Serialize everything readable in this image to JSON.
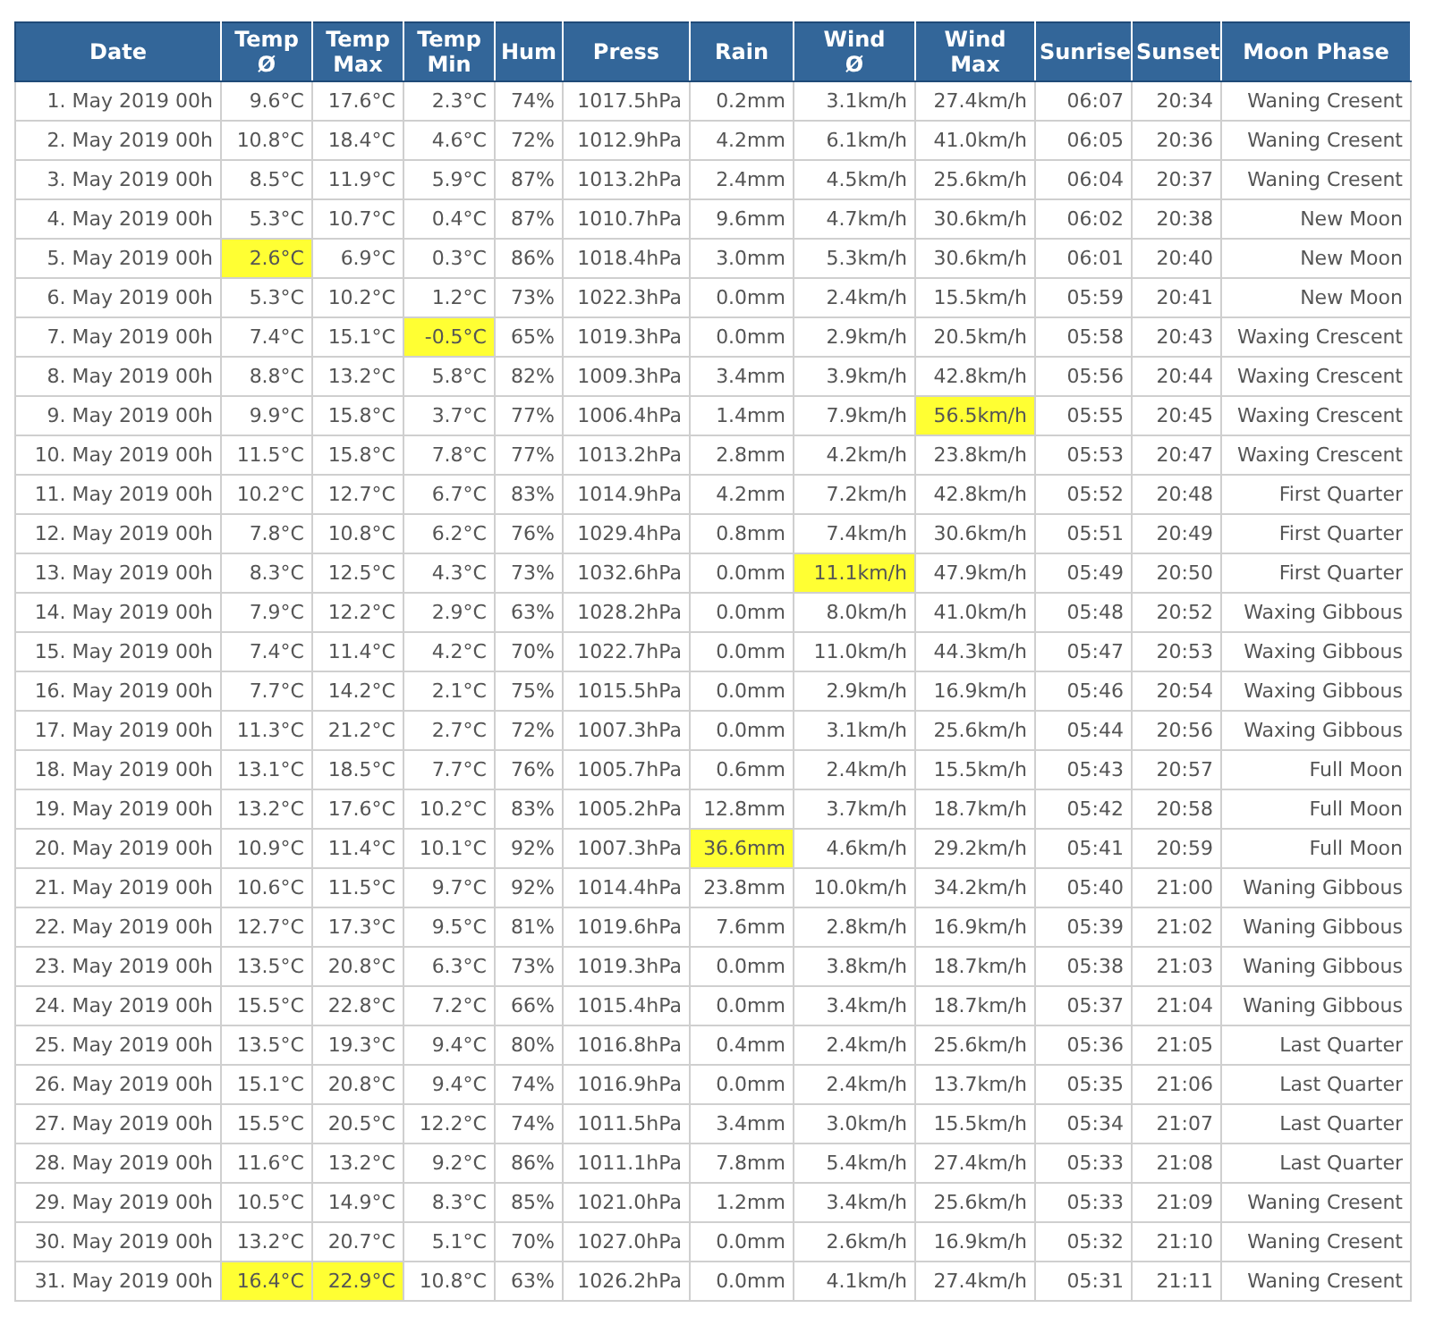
{
  "table": {
    "columns": [
      "Date",
      "Temp\nØ",
      "Temp\nMax",
      "Temp\nMin",
      "Hum",
      "Press",
      "Rain",
      "Wind\nØ",
      "Wind\nMax",
      "Sunrise",
      "Sunset",
      "Moon Phase"
    ],
    "rows": [
      {
        "cells": [
          "1. May 2019 00h",
          "9.6°C",
          "17.6°C",
          "2.3°C",
          "74%",
          "1017.5hPa",
          "0.2mm",
          "3.1km/h",
          "27.4km/h",
          "06:07",
          "20:34",
          "Waning Cresent"
        ],
        "highlighted": [
          false,
          false,
          false,
          false,
          false,
          false,
          false,
          false,
          false,
          false,
          false,
          false
        ]
      },
      {
        "cells": [
          "2. May 2019 00h",
          "10.8°C",
          "18.4°C",
          "4.6°C",
          "72%",
          "1012.9hPa",
          "4.2mm",
          "6.1km/h",
          "41.0km/h",
          "06:05",
          "20:36",
          "Waning Cresent"
        ],
        "highlighted": [
          false,
          false,
          false,
          false,
          false,
          false,
          false,
          false,
          false,
          false,
          false,
          false
        ]
      },
      {
        "cells": [
          "3. May 2019 00h",
          "8.5°C",
          "11.9°C",
          "5.9°C",
          "87%",
          "1013.2hPa",
          "2.4mm",
          "4.5km/h",
          "25.6km/h",
          "06:04",
          "20:37",
          "Waning Cresent"
        ],
        "highlighted": [
          false,
          false,
          false,
          false,
          false,
          false,
          false,
          false,
          false,
          false,
          false,
          false
        ]
      },
      {
        "cells": [
          "4. May 2019 00h",
          "5.3°C",
          "10.7°C",
          "0.4°C",
          "87%",
          "1010.7hPa",
          "9.6mm",
          "4.7km/h",
          "30.6km/h",
          "06:02",
          "20:38",
          "New Moon"
        ],
        "highlighted": [
          false,
          false,
          false,
          false,
          false,
          false,
          false,
          false,
          false,
          false,
          false,
          false
        ]
      },
      {
        "cells": [
          "5. May 2019 00h",
          "2.6°C",
          "6.9°C",
          "0.3°C",
          "86%",
          "1018.4hPa",
          "3.0mm",
          "5.3km/h",
          "30.6km/h",
          "06:01",
          "20:40",
          "New Moon"
        ],
        "highlighted": [
          false,
          true,
          false,
          false,
          false,
          false,
          false,
          false,
          false,
          false,
          false,
          false
        ]
      },
      {
        "cells": [
          "6. May 2019 00h",
          "5.3°C",
          "10.2°C",
          "1.2°C",
          "73%",
          "1022.3hPa",
          "0.0mm",
          "2.4km/h",
          "15.5km/h",
          "05:59",
          "20:41",
          "New Moon"
        ],
        "highlighted": [
          false,
          false,
          false,
          false,
          false,
          false,
          false,
          false,
          false,
          false,
          false,
          false
        ]
      },
      {
        "cells": [
          "7. May 2019 00h",
          "7.4°C",
          "15.1°C",
          "-0.5°C",
          "65%",
          "1019.3hPa",
          "0.0mm",
          "2.9km/h",
          "20.5km/h",
          "05:58",
          "20:43",
          "Waxing Crescent"
        ],
        "highlighted": [
          false,
          false,
          false,
          true,
          false,
          false,
          false,
          false,
          false,
          false,
          false,
          false
        ]
      },
      {
        "cells": [
          "8. May 2019 00h",
          "8.8°C",
          "13.2°C",
          "5.8°C",
          "82%",
          "1009.3hPa",
          "3.4mm",
          "3.9km/h",
          "42.8km/h",
          "05:56",
          "20:44",
          "Waxing Crescent"
        ],
        "highlighted": [
          false,
          false,
          false,
          false,
          false,
          false,
          false,
          false,
          false,
          false,
          false,
          false
        ]
      },
      {
        "cells": [
          "9. May 2019 00h",
          "9.9°C",
          "15.8°C",
          "3.7°C",
          "77%",
          "1006.4hPa",
          "1.4mm",
          "7.9km/h",
          "56.5km/h",
          "05:55",
          "20:45",
          "Waxing Crescent"
        ],
        "highlighted": [
          false,
          false,
          false,
          false,
          false,
          false,
          false,
          false,
          true,
          false,
          false,
          false
        ]
      },
      {
        "cells": [
          "10. May 2019 00h",
          "11.5°C",
          "15.8°C",
          "7.8°C",
          "77%",
          "1013.2hPa",
          "2.8mm",
          "4.2km/h",
          "23.8km/h",
          "05:53",
          "20:47",
          "Waxing Crescent"
        ],
        "highlighted": [
          false,
          false,
          false,
          false,
          false,
          false,
          false,
          false,
          false,
          false,
          false,
          false
        ]
      },
      {
        "cells": [
          "11. May 2019 00h",
          "10.2°C",
          "12.7°C",
          "6.7°C",
          "83%",
          "1014.9hPa",
          "4.2mm",
          "7.2km/h",
          "42.8km/h",
          "05:52",
          "20:48",
          "First Quarter"
        ],
        "highlighted": [
          false,
          false,
          false,
          false,
          false,
          false,
          false,
          false,
          false,
          false,
          false,
          false
        ]
      },
      {
        "cells": [
          "12. May 2019 00h",
          "7.8°C",
          "10.8°C",
          "6.2°C",
          "76%",
          "1029.4hPa",
          "0.8mm",
          "7.4km/h",
          "30.6km/h",
          "05:51",
          "20:49",
          "First Quarter"
        ],
        "highlighted": [
          false,
          false,
          false,
          false,
          false,
          false,
          false,
          false,
          false,
          false,
          false,
          false
        ]
      },
      {
        "cells": [
          "13. May 2019 00h",
          "8.3°C",
          "12.5°C",
          "4.3°C",
          "73%",
          "1032.6hPa",
          "0.0mm",
          "11.1km/h",
          "47.9km/h",
          "05:49",
          "20:50",
          "First Quarter"
        ],
        "highlighted": [
          false,
          false,
          false,
          false,
          false,
          false,
          false,
          true,
          false,
          false,
          false,
          false
        ]
      },
      {
        "cells": [
          "14. May 2019 00h",
          "7.9°C",
          "12.2°C",
          "2.9°C",
          "63%",
          "1028.2hPa",
          "0.0mm",
          "8.0km/h",
          "41.0km/h",
          "05:48",
          "20:52",
          "Waxing Gibbous"
        ],
        "highlighted": [
          false,
          false,
          false,
          false,
          false,
          false,
          false,
          false,
          false,
          false,
          false,
          false
        ]
      },
      {
        "cells": [
          "15. May 2019 00h",
          "7.4°C",
          "11.4°C",
          "4.2°C",
          "70%",
          "1022.7hPa",
          "0.0mm",
          "11.0km/h",
          "44.3km/h",
          "05:47",
          "20:53",
          "Waxing Gibbous"
        ],
        "highlighted": [
          false,
          false,
          false,
          false,
          false,
          false,
          false,
          false,
          false,
          false,
          false,
          false
        ]
      },
      {
        "cells": [
          "16. May 2019 00h",
          "7.7°C",
          "14.2°C",
          "2.1°C",
          "75%",
          "1015.5hPa",
          "0.0mm",
          "2.9km/h",
          "16.9km/h",
          "05:46",
          "20:54",
          "Waxing Gibbous"
        ],
        "highlighted": [
          false,
          false,
          false,
          false,
          false,
          false,
          false,
          false,
          false,
          false,
          false,
          false
        ]
      },
      {
        "cells": [
          "17. May 2019 00h",
          "11.3°C",
          "21.2°C",
          "2.7°C",
          "72%",
          "1007.3hPa",
          "0.0mm",
          "3.1km/h",
          "25.6km/h",
          "05:44",
          "20:56",
          "Waxing Gibbous"
        ],
        "highlighted": [
          false,
          false,
          false,
          false,
          false,
          false,
          false,
          false,
          false,
          false,
          false,
          false
        ]
      },
      {
        "cells": [
          "18. May 2019 00h",
          "13.1°C",
          "18.5°C",
          "7.7°C",
          "76%",
          "1005.7hPa",
          "0.6mm",
          "2.4km/h",
          "15.5km/h",
          "05:43",
          "20:57",
          "Full Moon"
        ],
        "highlighted": [
          false,
          false,
          false,
          false,
          false,
          false,
          false,
          false,
          false,
          false,
          false,
          false
        ]
      },
      {
        "cells": [
          "19. May 2019 00h",
          "13.2°C",
          "17.6°C",
          "10.2°C",
          "83%",
          "1005.2hPa",
          "12.8mm",
          "3.7km/h",
          "18.7km/h",
          "05:42",
          "20:58",
          "Full Moon"
        ],
        "highlighted": [
          false,
          false,
          false,
          false,
          false,
          false,
          false,
          false,
          false,
          false,
          false,
          false
        ]
      },
      {
        "cells": [
          "20. May 2019 00h",
          "10.9°C",
          "11.4°C",
          "10.1°C",
          "92%",
          "1007.3hPa",
          "36.6mm",
          "4.6km/h",
          "29.2km/h",
          "05:41",
          "20:59",
          "Full Moon"
        ],
        "highlighted": [
          false,
          false,
          false,
          false,
          false,
          false,
          true,
          false,
          false,
          false,
          false,
          false
        ]
      },
      {
        "cells": [
          "21. May 2019 00h",
          "10.6°C",
          "11.5°C",
          "9.7°C",
          "92%",
          "1014.4hPa",
          "23.8mm",
          "10.0km/h",
          "34.2km/h",
          "05:40",
          "21:00",
          "Waning Gibbous"
        ],
        "highlighted": [
          false,
          false,
          false,
          false,
          false,
          false,
          false,
          false,
          false,
          false,
          false,
          false
        ]
      },
      {
        "cells": [
          "22. May 2019 00h",
          "12.7°C",
          "17.3°C",
          "9.5°C",
          "81%",
          "1019.6hPa",
          "7.6mm",
          "2.8km/h",
          "16.9km/h",
          "05:39",
          "21:02",
          "Waning Gibbous"
        ],
        "highlighted": [
          false,
          false,
          false,
          false,
          false,
          false,
          false,
          false,
          false,
          false,
          false,
          false
        ]
      },
      {
        "cells": [
          "23. May 2019 00h",
          "13.5°C",
          "20.8°C",
          "6.3°C",
          "73%",
          "1019.3hPa",
          "0.0mm",
          "3.8km/h",
          "18.7km/h",
          "05:38",
          "21:03",
          "Waning Gibbous"
        ],
        "highlighted": [
          false,
          false,
          false,
          false,
          false,
          false,
          false,
          false,
          false,
          false,
          false,
          false
        ]
      },
      {
        "cells": [
          "24. May 2019 00h",
          "15.5°C",
          "22.8°C",
          "7.2°C",
          "66%",
          "1015.4hPa",
          "0.0mm",
          "3.4km/h",
          "18.7km/h",
          "05:37",
          "21:04",
          "Waning Gibbous"
        ],
        "highlighted": [
          false,
          false,
          false,
          false,
          false,
          false,
          false,
          false,
          false,
          false,
          false,
          false
        ]
      },
      {
        "cells": [
          "25. May 2019 00h",
          "13.5°C",
          "19.3°C",
          "9.4°C",
          "80%",
          "1016.8hPa",
          "0.4mm",
          "2.4km/h",
          "25.6km/h",
          "05:36",
          "21:05",
          "Last Quarter"
        ],
        "highlighted": [
          false,
          false,
          false,
          false,
          false,
          false,
          false,
          false,
          false,
          false,
          false,
          false
        ]
      },
      {
        "cells": [
          "26. May 2019 00h",
          "15.1°C",
          "20.8°C",
          "9.4°C",
          "74%",
          "1016.9hPa",
          "0.0mm",
          "2.4km/h",
          "13.7km/h",
          "05:35",
          "21:06",
          "Last Quarter"
        ],
        "highlighted": [
          false,
          false,
          false,
          false,
          false,
          false,
          false,
          false,
          false,
          false,
          false,
          false
        ]
      },
      {
        "cells": [
          "27. May 2019 00h",
          "15.5°C",
          "20.5°C",
          "12.2°C",
          "74%",
          "1011.5hPa",
          "3.4mm",
          "3.0km/h",
          "15.5km/h",
          "05:34",
          "21:07",
          "Last Quarter"
        ],
        "highlighted": [
          false,
          false,
          false,
          false,
          false,
          false,
          false,
          false,
          false,
          false,
          false,
          false
        ]
      },
      {
        "cells": [
          "28. May 2019 00h",
          "11.6°C",
          "13.2°C",
          "9.2°C",
          "86%",
          "1011.1hPa",
          "7.8mm",
          "5.4km/h",
          "27.4km/h",
          "05:33",
          "21:08",
          "Last Quarter"
        ],
        "highlighted": [
          false,
          false,
          false,
          false,
          false,
          false,
          false,
          false,
          false,
          false,
          false,
          false
        ]
      },
      {
        "cells": [
          "29. May 2019 00h",
          "10.5°C",
          "14.9°C",
          "8.3°C",
          "85%",
          "1021.0hPa",
          "1.2mm",
          "3.4km/h",
          "25.6km/h",
          "05:33",
          "21:09",
          "Waning Cresent"
        ],
        "highlighted": [
          false,
          false,
          false,
          false,
          false,
          false,
          false,
          false,
          false,
          false,
          false,
          false
        ]
      },
      {
        "cells": [
          "30. May 2019 00h",
          "13.2°C",
          "20.7°C",
          "5.1°C",
          "70%",
          "1027.0hPa",
          "0.0mm",
          "2.6km/h",
          "16.9km/h",
          "05:32",
          "21:10",
          "Waning Cresent"
        ],
        "highlighted": [
          false,
          false,
          false,
          false,
          false,
          false,
          false,
          false,
          false,
          false,
          false,
          false
        ]
      },
      {
        "cells": [
          "31. May 2019 00h",
          "16.4°C",
          "22.9°C",
          "10.8°C",
          "63%",
          "1026.2hPa",
          "0.0mm",
          "4.1km/h",
          "27.4km/h",
          "05:31",
          "21:11",
          "Waning Cresent"
        ],
        "highlighted": [
          false,
          true,
          true,
          false,
          false,
          false,
          false,
          false,
          false,
          false,
          false,
          false
        ]
      }
    ]
  }
}
